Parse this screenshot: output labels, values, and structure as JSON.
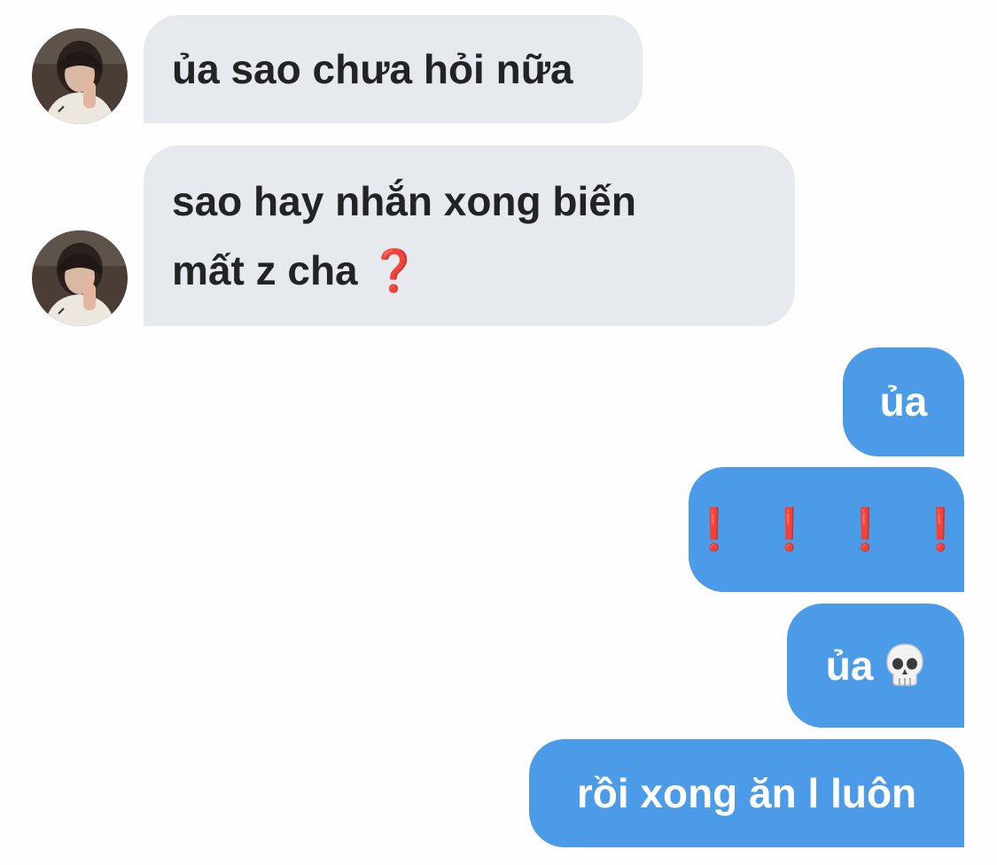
{
  "messages": [
    {
      "side": "in",
      "text": "ủa sao chưa hỏi nữa"
    },
    {
      "side": "in",
      "lines": [
        "sao hay nhắn xong biến",
        "mất z cha"
      ],
      "emoji": "❓",
      "emoji_icon": "red-question-mark-icon"
    },
    {
      "side": "out",
      "text": "ủa"
    },
    {
      "side": "out",
      "emoji_text": "❗ ❗ ❗ ❗",
      "emoji_icon": "red-exclamation-mark-icon"
    },
    {
      "side": "out",
      "text": "ủa",
      "emoji_icon": "skull-icon"
    },
    {
      "side": "out",
      "text": "rồi xong ăn l luôn"
    }
  ],
  "colors": {
    "incoming_bubble": "#e6eaee",
    "outgoing_bubble": "#4c9be8",
    "incoming_text": "#222325",
    "outgoing_text": "#ffffff",
    "emoji_red": "#d0302c"
  }
}
